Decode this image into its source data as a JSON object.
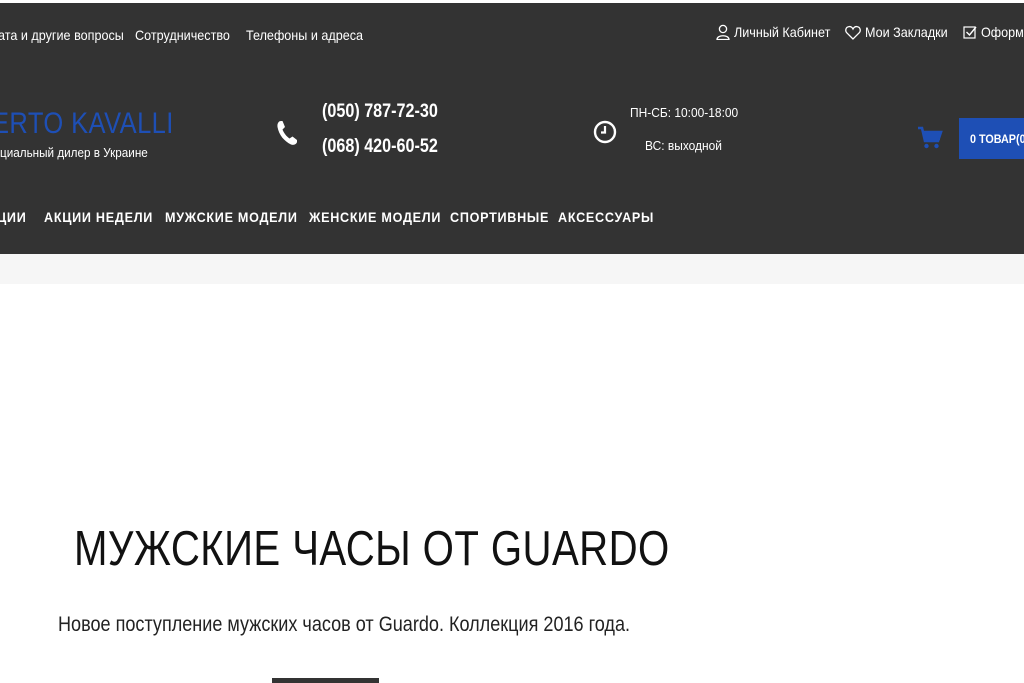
{
  "topbar": {
    "links": [
      "ата и другие вопросы",
      "Сотрудничество",
      "Телефоны и адреса"
    ],
    "account_label": "Личный Кабинет",
    "bookmarks_label": "Мои Закладки",
    "checkout_label": "Оформ"
  },
  "logo": {
    "name": "ERTO KAVALLI",
    "tagline": "циальный дилер в Украине"
  },
  "contacts": {
    "phones": [
      "(050) 787-72-30",
      "(068) 420-60-52"
    ]
  },
  "hours": {
    "weekdays": "ПН-СБ: 10:00-18:00",
    "sunday": "ВС: выходной"
  },
  "cart": {
    "label": "0 ТОВАР(0"
  },
  "nav": {
    "items": [
      "ЦИИ",
      "АКЦИИ НЕДЕЛИ",
      "МУЖСКИЕ МОДЕЛИ",
      "ЖЕНСКИЕ МОДЕЛИ",
      "СПОРТИВНЫЕ",
      "АКСЕССУАРЫ"
    ]
  },
  "hero": {
    "title": "МУЖСКИЕ ЧАСЫ ОТ GUARDO",
    "subtitle": "Новое поступление мужских часов от Guardo. Коллекция 2016 года."
  },
  "colors": {
    "header_bg": "#333333",
    "accent": "#1e4fb5",
    "page_bg": "#ffffff"
  }
}
